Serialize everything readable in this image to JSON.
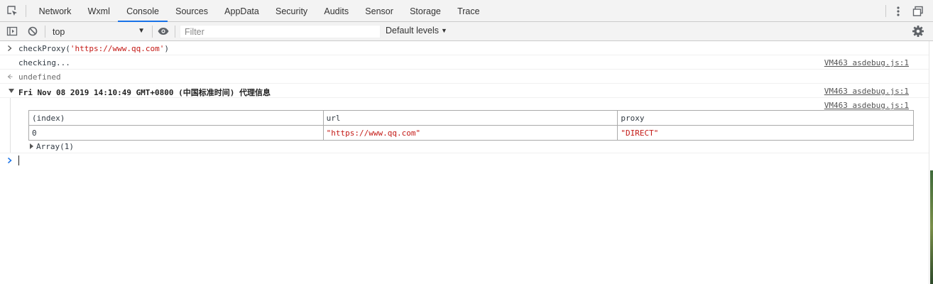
{
  "tabs": {
    "items": [
      {
        "label": "Network"
      },
      {
        "label": "Wxml"
      },
      {
        "label": "Console",
        "selected": true
      },
      {
        "label": "Sources"
      },
      {
        "label": "AppData"
      },
      {
        "label": "Security"
      },
      {
        "label": "Audits"
      },
      {
        "label": "Sensor"
      },
      {
        "label": "Storage"
      },
      {
        "label": "Trace"
      }
    ],
    "accent_color": "#1a73e8"
  },
  "toolbar": {
    "context": "top",
    "filter_placeholder": "Filter",
    "levels_label": "Default levels"
  },
  "console": {
    "entries": {
      "input_cmd": {
        "fn": "checkProxy(",
        "arg": "'https://www.qq.com'",
        "close": ")"
      },
      "log_checking": {
        "text": "checking...",
        "source": "VM463 asdebug.js:1"
      },
      "result_undefined": {
        "text": "undefined"
      },
      "group": {
        "title": "Fri Nov 08 2019 14:10:49 GMT+0800 (中国标准时间) 代理信息",
        "source": "VM463 asdebug.js:1"
      },
      "table_log": {
        "source": "VM463 asdebug.js:1",
        "headers": [
          "(index)",
          "url",
          "proxy"
        ],
        "rows": [
          {
            "index": "0",
            "url": "\"https://www.qq.com\"",
            "proxy": "\"DIRECT\""
          }
        ],
        "array_label": "Array(1)"
      }
    },
    "string_color": "#c41a16",
    "prompt_color": "#1a73e8"
  }
}
